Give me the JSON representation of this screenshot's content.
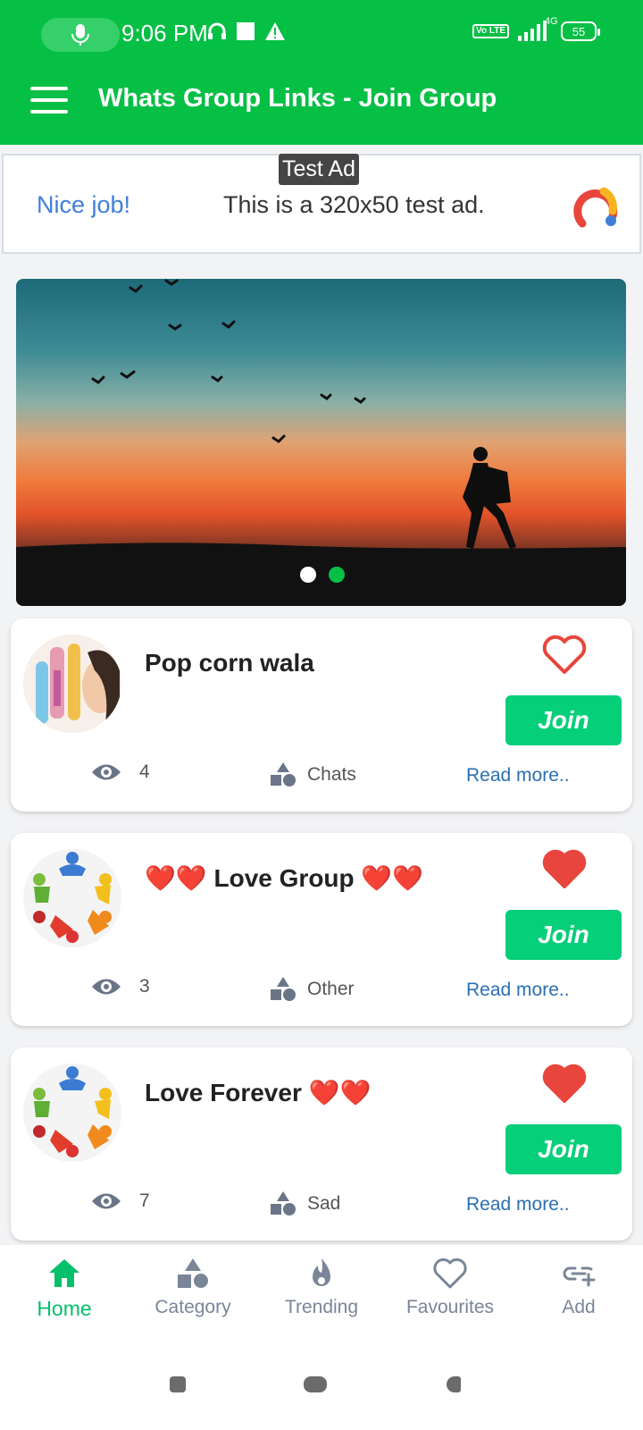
{
  "status_bar": {
    "time": "9:06 PM",
    "network": "4G",
    "battery": "55",
    "volte": "Vo LTE"
  },
  "app_bar": {
    "title": "Whats Group Links - Join Group"
  },
  "ad": {
    "tag": "Test Ad",
    "headline": "Nice job!",
    "text": "This is a 320x50 test ad."
  },
  "carousel": {
    "slides": 2,
    "active_index": 1
  },
  "groups": [
    {
      "title": "Pop corn wala",
      "views": "4",
      "category": "Chats",
      "join_label": "Join",
      "read_more": "Read more..",
      "favourite": false
    },
    {
      "title": "❤️❤️ Love Group ❤️❤️",
      "views": "3",
      "category": "Other",
      "join_label": "Join",
      "read_more": "Read more..",
      "favourite": true
    },
    {
      "title": "Love Forever ❤️❤️",
      "views": "7",
      "category": "Sad",
      "join_label": "Join",
      "read_more": "Read more..",
      "favourite": true
    }
  ],
  "bottom_nav": [
    {
      "label": "Home",
      "icon": "home-icon",
      "active": true
    },
    {
      "label": "Category",
      "icon": "category-icon",
      "active": false
    },
    {
      "label": "Trending",
      "icon": "flame-icon",
      "active": false
    },
    {
      "label": "Favourites",
      "icon": "heart-icon",
      "active": false
    },
    {
      "label": "Add",
      "icon": "add-link-icon",
      "active": false
    }
  ],
  "colors": {
    "primary": "#06bf45",
    "join": "#06cf7a",
    "heart": "#e8453c",
    "link": "#2a6fb0",
    "nav_inactive": "#7a8597"
  }
}
